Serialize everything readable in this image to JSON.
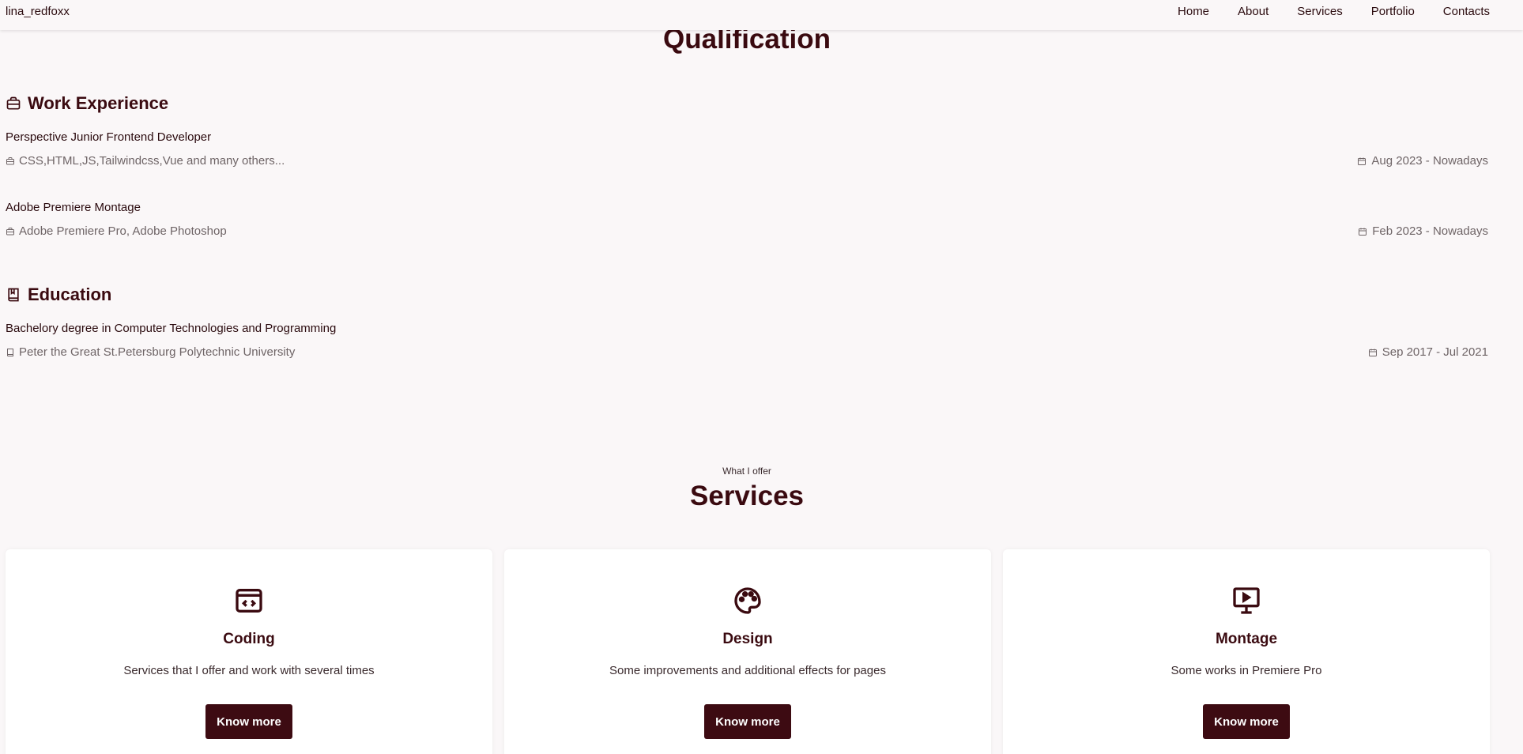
{
  "nav": {
    "logo": "lina_redfoxx",
    "links": [
      "Home",
      "About",
      "Services",
      "Portfolio",
      "Contacts"
    ]
  },
  "qualification": {
    "title": "Qualification",
    "work": {
      "title": "Work Experience",
      "icon": "briefcase-icon",
      "entries": [
        {
          "title": "Perspective Junior Frontend Developer",
          "subtitle": "CSS,HTML,JS,Tailwindcss,Vue and many others...",
          "date": "Aug 2023 - Nowadays"
        },
        {
          "title": "Adobe Premiere Montage",
          "subtitle": "Adobe Premiere Pro, Adobe Photoshop",
          "date": "Feb 2023 - Nowadays"
        }
      ]
    },
    "education": {
      "title": "Education",
      "icon": "book-icon",
      "entries": [
        {
          "title": "Bachelory degree in Computer Technologies and Programming",
          "subtitle": "Peter the Great St.Petersburg Polytechnic University",
          "date": "Sep 2017 - Jul 2021"
        }
      ]
    }
  },
  "services": {
    "subtitle": "What I offer",
    "title": "Services",
    "cards": [
      {
        "icon": "code-window-icon",
        "title": "Coding",
        "description": "Services that I offer and work with several times",
        "button": "Know more"
      },
      {
        "icon": "palette-icon",
        "title": "Design",
        "description": "Some improvements and additional effects for pages",
        "button": "Know more"
      },
      {
        "icon": "monitor-play-icon",
        "title": "Montage",
        "description": "Some works in Premiere Pro",
        "button": "Know more"
      }
    ]
  },
  "colors": {
    "accent": "#3d0b12",
    "background": "#faf7f8",
    "muted_text": "#6e6466"
  }
}
